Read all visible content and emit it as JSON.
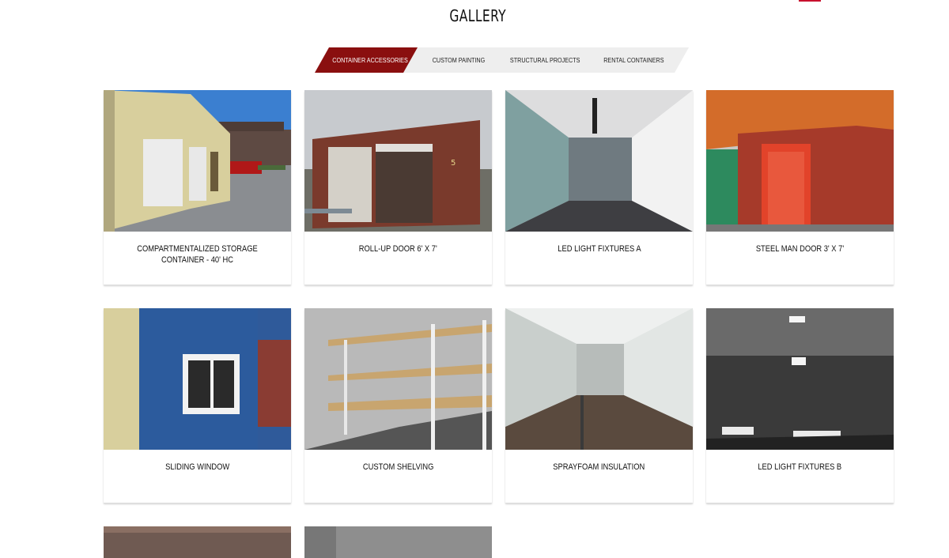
{
  "gallery": {
    "title": "GALLERY",
    "tabs": [
      {
        "label": "CONTAINER ACCESSORIES",
        "active": true
      },
      {
        "label": "CUSTOM PAINTING",
        "active": false
      },
      {
        "label": "STRUCTURAL PROJECTS",
        "active": false
      },
      {
        "label": "RENTAL CONTAINERS",
        "active": false
      }
    ],
    "items": [
      {
        "caption": "COMPARTMENTALIZED STORAGE CONTAINER - 40' HC"
      },
      {
        "caption": "ROLL-UP DOOR 6' X 7'"
      },
      {
        "caption": "LED LIGHT FIXTURES A"
      },
      {
        "caption": "STEEL MAN DOOR 3' X 7'"
      },
      {
        "caption": "SLIDING WINDOW"
      },
      {
        "caption": "CUSTOM SHELVING"
      },
      {
        "caption": "SPRAYFOAM INSULATION"
      },
      {
        "caption": "LED LIGHT FIXTURES B"
      }
    ]
  },
  "colors": {
    "accent": "#8a0f0f",
    "tab_bg": "#eeeeee"
  }
}
